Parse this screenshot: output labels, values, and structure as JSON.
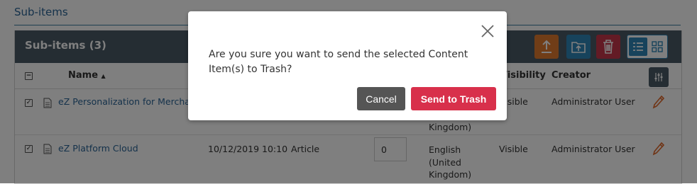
{
  "section": {
    "title": "Sub-items"
  },
  "panel": {
    "title": "Sub-items (3)"
  },
  "table": {
    "headers": {
      "name": "Name",
      "sort_indicator": "▲",
      "visibility": "Visibility",
      "creator": "Creator"
    },
    "rows": [
      {
        "checked": true,
        "name": "eZ Personalization for Merchandisers",
        "language": "Kingdom)",
        "visibility": "Visible",
        "creator": "Administrator User"
      },
      {
        "checked": true,
        "name": "eZ Platform Cloud",
        "modified": "10/12/2019 10:10",
        "type": "Article",
        "priority": "0",
        "language_lines": [
          "English",
          "(United",
          "Kingdom)"
        ],
        "visibility": "Visible",
        "creator": "Administrator User"
      }
    ]
  },
  "icons": {
    "upload": "upload-icon",
    "move": "move-folder-icon",
    "trash": "trash-icon",
    "list_view": "list-view-icon",
    "grid_view": "grid-view-icon",
    "column_settings": "column-settings-icon",
    "doc": "document-icon",
    "edit": "pencil-icon",
    "close": "close-icon"
  },
  "colors": {
    "header_bg": "#4a5a66",
    "accent_blue": "#2e86b8",
    "accent_orange": "#e07a2e",
    "danger": "#d8304b",
    "cancel_bg": "#555555"
  },
  "modal": {
    "message": "Are you sure you want to send the selected Content Item(s) to Trash?",
    "cancel_label": "Cancel",
    "confirm_label": "Send to Trash"
  }
}
